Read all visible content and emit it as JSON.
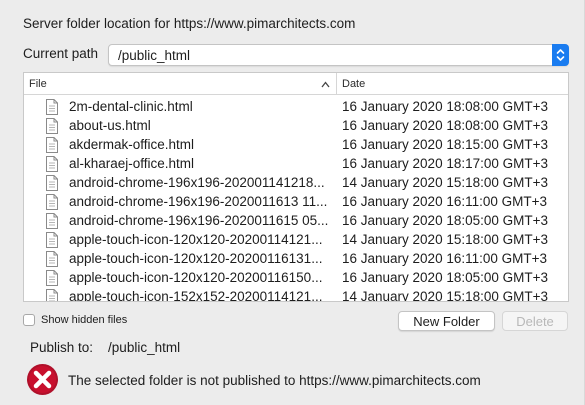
{
  "dialog": {
    "title": "Server folder location for https://www.pimarchitects.com",
    "current_path_label": "Current path",
    "current_path_value": "/public_html"
  },
  "table": {
    "col_file": "File",
    "col_date": "Date",
    "rows": [
      {
        "name": "2m-dental-clinic.html",
        "date": "16 January 2020 18:08:00 GMT+3"
      },
      {
        "name": "about-us.html",
        "date": "16 January 2020 18:08:00 GMT+3"
      },
      {
        "name": "akdermak-office.html",
        "date": "16 January 2020 18:15:00 GMT+3"
      },
      {
        "name": "al-kharaej-office.html",
        "date": "16 January 2020 18:17:00 GMT+3"
      },
      {
        "name": "android-chrome-196x196-202001141218...",
        "date": "14 January 2020 15:18:00 GMT+3"
      },
      {
        "name": "android-chrome-196x196-2020011613 11...",
        "date": "16 January 2020 16:11:00 GMT+3"
      },
      {
        "name": "android-chrome-196x196-2020011615 05...",
        "date": "16 January 2020 18:05:00 GMT+3"
      },
      {
        "name": "apple-touch-icon-120x120-20200114121...",
        "date": "14 January 2020 15:18:00 GMT+3"
      },
      {
        "name": "apple-touch-icon-120x120-20200116131...",
        "date": "16 January 2020 16:11:00 GMT+3"
      },
      {
        "name": "apple-touch-icon-120x120-20200116150...",
        "date": "16 January 2020 18:05:00 GMT+3"
      },
      {
        "name": "apple-touch-icon-152x152-20200114121...",
        "date": "14 January 2020 15:18:00 GMT+3"
      }
    ]
  },
  "options": {
    "show_hidden_label": "Show hidden files",
    "new_folder_label": "New Folder",
    "delete_label": "Delete"
  },
  "publish": {
    "label": "Publish to:",
    "value": "/public_html"
  },
  "error": {
    "message": "The selected folder is not published to https://www.pimarchitects.com",
    "icon": "error-x-icon",
    "color": "#b0102a"
  },
  "colors": {
    "accent": "#1a7cf0"
  }
}
